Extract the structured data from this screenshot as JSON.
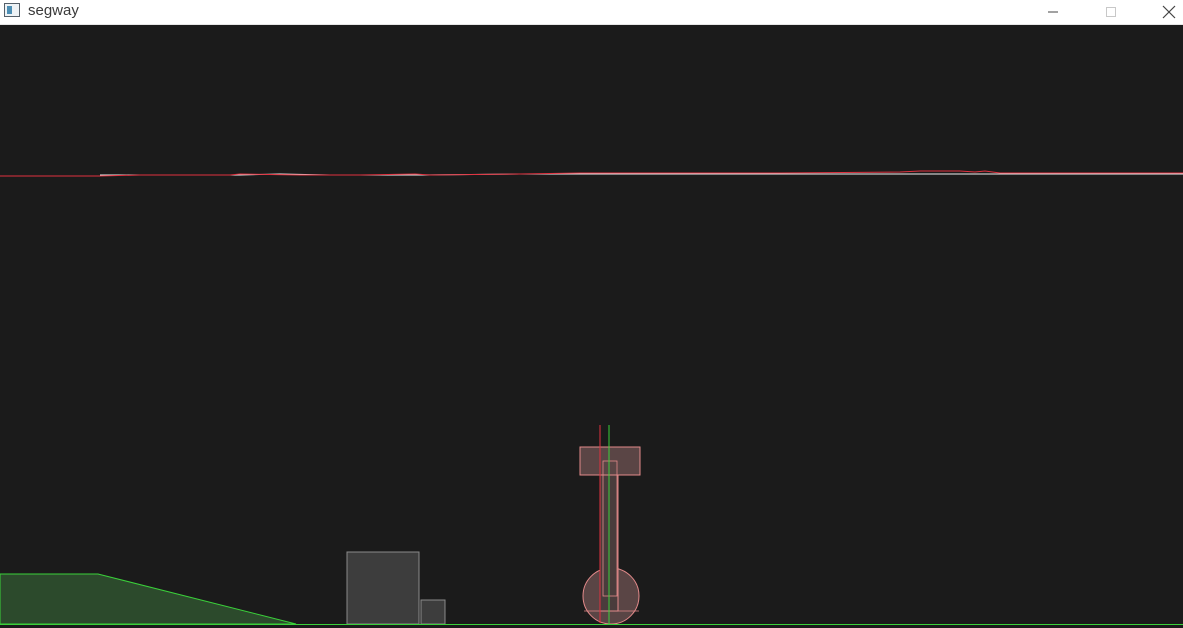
{
  "window": {
    "title": "segway",
    "icons": {
      "app": "app-window-icon",
      "minimize": "minimize-icon",
      "maximize": "maximize-icon",
      "close": "close-icon"
    }
  },
  "scene": {
    "background_color": "#1b1b1b",
    "ground_color": "#3ad13a",
    "ramp_fill_color": "#2c4a2c",
    "body_outline_color": "#e38a8a",
    "body_fill_color": "#5a4545",
    "box_fill_color": "#3d3d3d",
    "box_outline_color": "#8a8a8a",
    "plot_red_color": "#e0313f",
    "plot_white_color": "#f0f0f0",
    "reference_line_color": "#3ad13a"
  }
}
